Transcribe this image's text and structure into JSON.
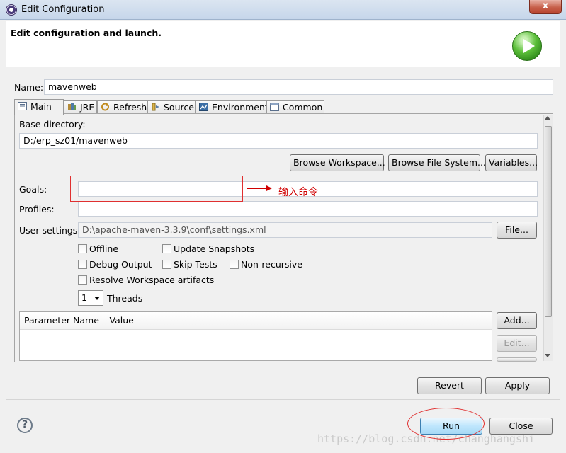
{
  "window": {
    "title": "Edit Configuration",
    "close_glyph": "x"
  },
  "header": {
    "heading": "Edit configuration and launch.",
    "icon": "run-launch-icon"
  },
  "name": {
    "label": "Name:",
    "value": "mavenweb"
  },
  "tabs": [
    {
      "label": "Main",
      "icon": "main-tab-icon",
      "active": true
    },
    {
      "label": "JRE",
      "icon": "jre-icon"
    },
    {
      "label": "Refresh",
      "icon": "refresh-icon"
    },
    {
      "label": "Source",
      "icon": "source-icon"
    },
    {
      "label": "Environment",
      "icon": "environment-icon"
    },
    {
      "label": "Common",
      "icon": "common-icon"
    }
  ],
  "main": {
    "base_dir_label": "Base directory:",
    "base_dir_value": "D:/erp_sz01/mavenweb",
    "browse_workspace": "Browse Workspace...",
    "browse_fs": "Browse File System...",
    "variables": "Variables...",
    "goals_label": "Goals:",
    "goals_value": "",
    "profiles_label": "Profiles:",
    "profiles_value": "",
    "user_settings_label": "User settings:",
    "user_settings_value": "D:\\apache-maven-3.3.9\\conf\\settings.xml",
    "file_button": "File...",
    "checkboxes": {
      "offline": "Offline",
      "update_snapshots": "Update Snapshots",
      "debug_output": "Debug Output",
      "skip_tests": "Skip Tests",
      "non_recursive": "Non-recursive",
      "resolve_workspace": "Resolve Workspace artifacts"
    },
    "threads_value": "1",
    "threads_label": "Threads",
    "table": {
      "headers": [
        "Parameter Name",
        "Value"
      ]
    },
    "add_button": "Add...",
    "edit_button": "Edit..."
  },
  "annotation": {
    "text": "输入命令",
    "color": "#d00000"
  },
  "buttons": {
    "revert": "Revert",
    "apply": "Apply",
    "run": "Run",
    "close": "Close"
  },
  "watermark": "https://blog.csdn.net/changhangshi"
}
